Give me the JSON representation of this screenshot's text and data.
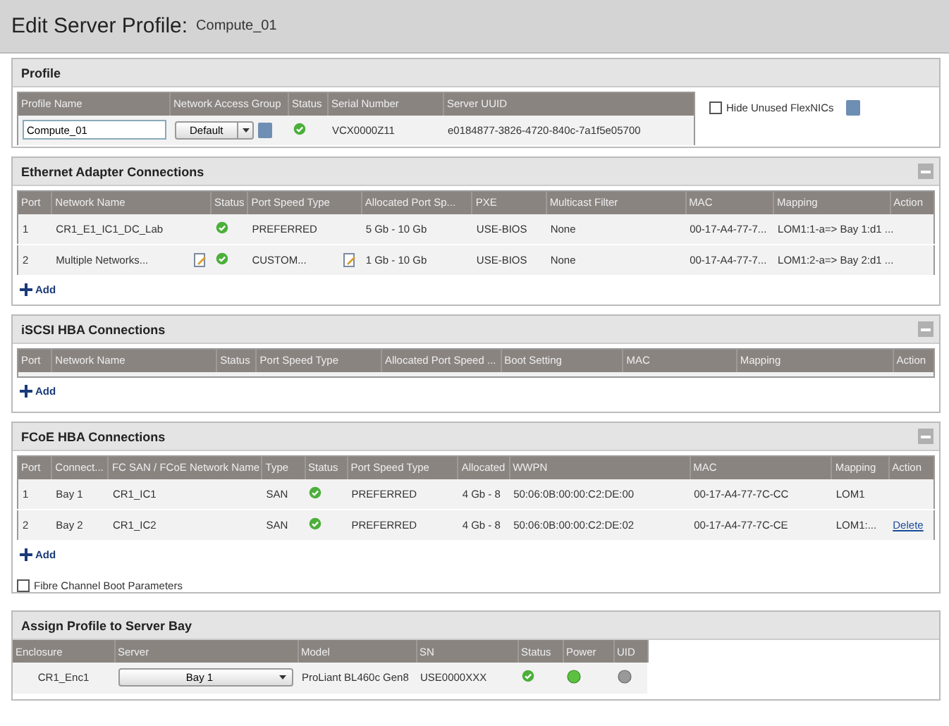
{
  "page_title": "Edit Server Profile:",
  "profile_label": "Compute_01",
  "profile": {
    "title": "Profile",
    "columns": [
      "Profile Name",
      "Network Access Group",
      "Status",
      "Serial Number",
      "Server UUID"
    ],
    "name_value": "Compute_01",
    "group_value": "Default",
    "status_ok": true,
    "serial": "VCX0000Z11",
    "uuid": "e0184877-3826-4720-840c-7a1f5e05700",
    "hide_unused": {
      "label": "Hide Unused FlexNICs",
      "checked": false
    }
  },
  "sections": [
    {
      "kind": "ethernet",
      "title": "Ethernet Adapter Connections",
      "add": "Add",
      "columns": [
        "Port",
        "Network Name",
        "Status",
        "Port Speed Type",
        "Allocated Port Sp...",
        "PXE",
        "Multicast Filter",
        "MAC",
        "Mapping",
        "Action"
      ],
      "rows": [
        {
          "cells": [
            {
              "text": "1"
            },
            {
              "text": "CR1_E1_IC1_DC_Lab",
              "editable": false
            },
            {
              "kind": "status"
            },
            {
              "text": "PREFERRED",
              "editable": false
            },
            {
              "text": "5 Gb - 10 Gb"
            },
            {
              "text": "USE-BIOS"
            },
            {
              "text": "None"
            },
            {
              "text": "00-17-A4-77-7..."
            },
            {
              "text": "LOM1:1-a=> Bay 1:d1 ..."
            }
          ]
        },
        {
          "cells": [
            {
              "text": "2"
            },
            {
              "text": "Multiple Networks...",
              "editable": true
            },
            {
              "kind": "status"
            },
            {
              "text": "CUSTOM...",
              "editable": true
            },
            {
              "text": "1 Gb - 10 Gb"
            },
            {
              "text": "USE-BIOS"
            },
            {
              "text": "None"
            },
            {
              "text": "00-17-A4-77-7..."
            },
            {
              "text": "LOM1:2-a=> Bay 2:d1 ..."
            }
          ]
        }
      ]
    },
    {
      "kind": "iscsi",
      "title": "iSCSI HBA Connections",
      "add": "Add",
      "columns": [
        "Port",
        "Network Name",
        "Status",
        "Port Speed Type",
        "Allocated Port Speed ...",
        "Boot Setting",
        "MAC",
        "Mapping",
        "Action"
      ]
    },
    {
      "kind": "fcoe",
      "title": "FCoE HBA Connections",
      "add": "Add",
      "columns": [
        "Port",
        "Connect...",
        "FC SAN / FCoE Network Name",
        "Type",
        "Status",
        "Port Speed Type",
        "Allocated",
        "WWPN",
        "MAC",
        "Mapping",
        "Action"
      ],
      "rows": [
        {
          "cells": [
            {
              "text": "1"
            },
            {
              "text": "Bay 1"
            },
            {
              "text": "CR1_IC1"
            },
            {
              "text": "SAN"
            },
            {
              "kind": "status"
            },
            {
              "text": "PREFERRED"
            },
            {
              "text": "4 Gb - 8"
            },
            {
              "text": "50:06:0B:00:00:C2:DE:00"
            },
            {
              "text": "00-17-A4-77-7C-CC"
            },
            {
              "text": "LOM1"
            }
          ]
        },
        {
          "cells": [
            {
              "text": "2"
            },
            {
              "text": "Bay 2"
            },
            {
              "text": "CR1_IC2"
            },
            {
              "text": "SAN"
            },
            {
              "kind": "status"
            },
            {
              "text": "PREFERRED"
            },
            {
              "text": "4 Gb - 8"
            },
            {
              "text": "50:06:0B:00:00:C2:DE:02"
            },
            {
              "text": "00-17-A4-77-7C-CE"
            },
            {
              "text": "LOM1:..."
            },
            {
              "kind": "link",
              "text": "Delete"
            }
          ]
        }
      ],
      "boot": {
        "label": "Fibre Channel Boot Parameters",
        "checked": false
      }
    }
  ],
  "assign": {
    "title": "Assign Profile to Server Bay",
    "columns": [
      "Enclosure",
      "Server",
      "Model",
      "SN",
      "Status",
      "Power",
      "UID"
    ],
    "enclosure": "CR1_Enc1",
    "server": "Bay 1",
    "model": "ProLiant BL460c Gen8",
    "sn": "USE0000XXX",
    "status_ok": true,
    "power_on": true,
    "uid_on": false
  }
}
